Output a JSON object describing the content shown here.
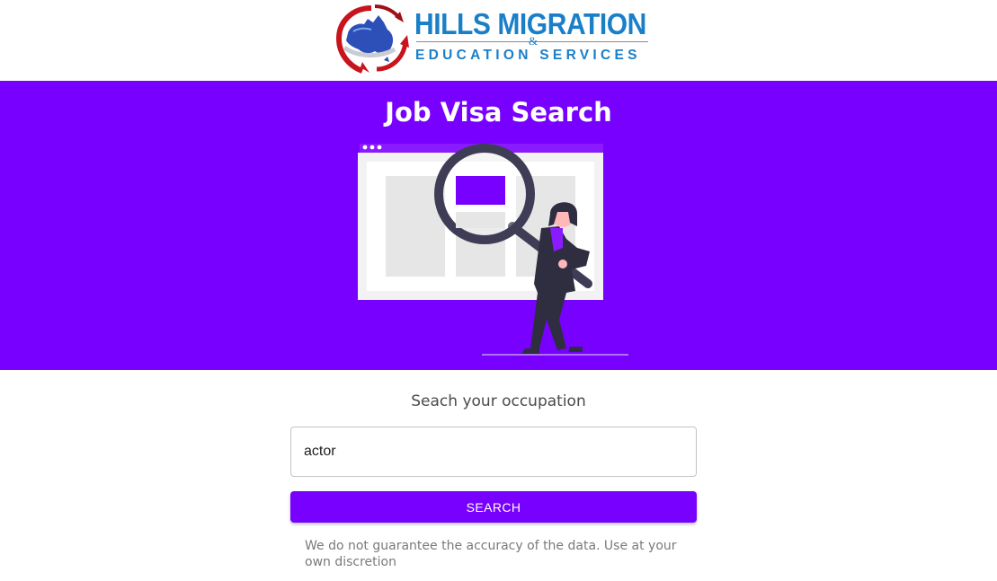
{
  "brand": {
    "name_line1": "HILLS MIGRATION",
    "ampersand": "&",
    "name_line2": "EDUCATION SERVICES",
    "color": "#1a7fc9",
    "logo_icon": "australia-arrows-logo-icon"
  },
  "hero": {
    "title": "Job Visa Search",
    "background": "#7800fe",
    "illustration_icon": "woman-with-magnifying-glass-illustration"
  },
  "search": {
    "label": "Seach your occupation",
    "value": "actor",
    "placeholder": "",
    "button_label": "SEARCH"
  },
  "disclaimer": "We do not guarantee the accuracy of the data. Use at your own discretion"
}
